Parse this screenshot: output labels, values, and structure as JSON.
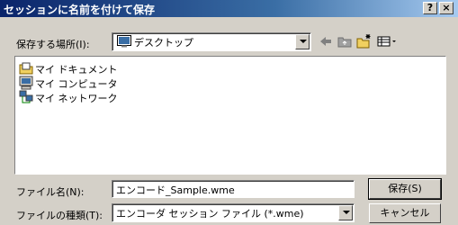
{
  "dialog": {
    "title": "セッションに名前を付けて保存",
    "help_button": "?",
    "close_button": "×"
  },
  "location": {
    "label": "保存する場所(I):",
    "value": "デスクトップ"
  },
  "toolbar": {
    "icons": [
      "back-arrow-icon",
      "up-folder-icon",
      "new-folder-icon",
      "view-menu-icon"
    ]
  },
  "files": [
    {
      "icon": "my-documents-icon",
      "name": "マイ ドキュメント"
    },
    {
      "icon": "my-computer-icon",
      "name": "マイ コンピュータ"
    },
    {
      "icon": "my-network-icon",
      "name": "マイ ネットワーク"
    }
  ],
  "filename": {
    "label": "ファイル名(N):",
    "value": "エンコード_Sample.wme"
  },
  "filetype": {
    "label": "ファイルの種類(T):",
    "value": "エンコーダ セッション ファイル (*.wme)"
  },
  "buttons": {
    "save": "保存(S)",
    "cancel": "キャンセル"
  }
}
